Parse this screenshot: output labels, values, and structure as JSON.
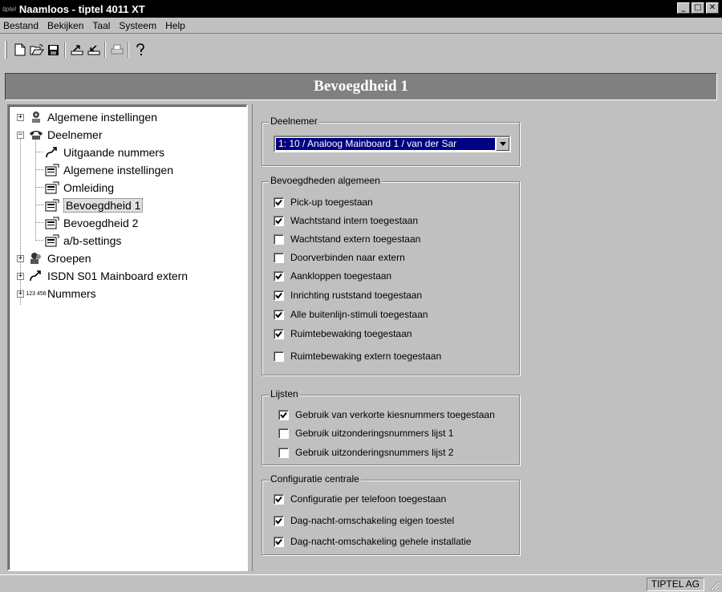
{
  "window": {
    "app_icon_text": "tiptel",
    "title": "Naamloos - tiptel 4011 XT",
    "minimize_label": "_",
    "maximize_label": "□",
    "close_label": "✕"
  },
  "menu": [
    "Bestand",
    "Bekijken",
    "Taal",
    "Systeem",
    "Help"
  ],
  "toolbar": {
    "buttons": [
      "new-file-icon",
      "open-folder-icon",
      "save-disk-icon",
      "upload-icon",
      "download-icon",
      "print-icon",
      "help-icon"
    ]
  },
  "header": {
    "title": "Bevoegdheid 1"
  },
  "tree": {
    "items": [
      {
        "label": "Algemene instellingen",
        "icon": "settings-person-icon"
      },
      {
        "label": "Deelnemer",
        "icon": "phone-icon"
      },
      {
        "label": "Uitgaande nummers",
        "icon": "outgoing-call-icon"
      },
      {
        "label": "Algemene instellingen",
        "icon": "config-page-icon"
      },
      {
        "label": "Omleiding",
        "icon": "config-page-icon"
      },
      {
        "label": "Bevoegdheid 1",
        "icon": "config-page-icon"
      },
      {
        "label": "Bevoegdheid 2",
        "icon": "config-page-icon"
      },
      {
        "label": "a/b-settings",
        "icon": "config-page-icon"
      },
      {
        "label": "Groepen",
        "icon": "group-icon"
      },
      {
        "label": "ISDN S01 Mainboard extern",
        "icon": "isdn-icon"
      },
      {
        "label": "Nummers",
        "icon": "numbers-icon"
      }
    ],
    "expander_plus": "+",
    "expander_minus": "−",
    "numbers_icon_text": "123 456"
  },
  "deelnemer": {
    "group_label": "Deelnemer",
    "selected": "1: 10 / Analoog Mainboard 1 / van der Sar"
  },
  "bevoegdheden": {
    "group_label": "Bevoegdheden algemeen",
    "items": [
      {
        "label": "Pick-up toegestaan",
        "checked": true
      },
      {
        "label": "Wachtstand intern toegestaan",
        "checked": true
      },
      {
        "label": "Wachtstand extern toegestaan",
        "checked": false
      },
      {
        "label": "Doorverbinden naar extern",
        "checked": false
      },
      {
        "label": "Aankloppen toegestaan",
        "checked": true
      },
      {
        "label": "Inrichting ruststand toegestaan",
        "checked": true
      },
      {
        "label": "Alle buitenlijn-stimuli toegestaan",
        "checked": true
      },
      {
        "label": "Ruimtebewaking toegestaan",
        "checked": true
      },
      {
        "label": "Ruimtebewaking extern toegestaan",
        "checked": false
      }
    ]
  },
  "lijsten": {
    "group_label": "Lijsten",
    "items": [
      {
        "label": "Gebruik van verkorte kiesnummers toegestaan",
        "checked": true
      },
      {
        "label": "Gebruik uitzonderingsnummers lijst 1",
        "checked": false
      },
      {
        "label": "Gebruik uitzonderingsnummers lijst 2",
        "checked": false
      }
    ]
  },
  "configuratie": {
    "group_label": "Configuratie centrale",
    "items": [
      {
        "label": "Configuratie per telefoon toegestaan",
        "checked": true
      },
      {
        "label": "Dag-nacht-omschakeling eigen toestel",
        "checked": true
      },
      {
        "label": "Dag-nacht-omschakeling gehele installatie",
        "checked": true
      }
    ]
  },
  "status": {
    "text": "TIPTEL AG"
  }
}
